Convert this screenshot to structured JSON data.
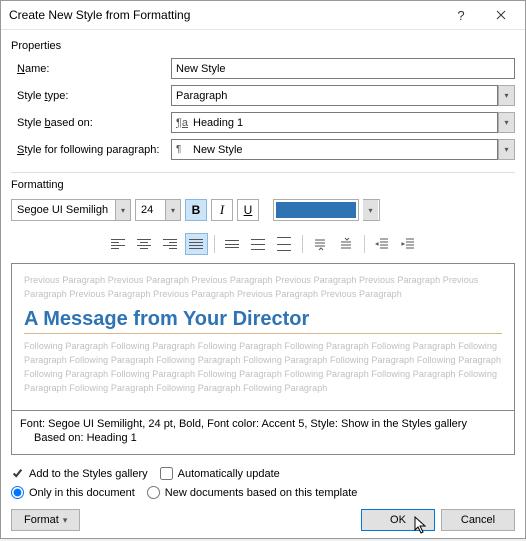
{
  "titlebar": {
    "title": "Create New Style from Formatting"
  },
  "sections": {
    "properties": "Properties",
    "formatting": "Formatting"
  },
  "props": {
    "name_label": "Name:",
    "name_value": "New Style",
    "styletype_label": "Style type:",
    "styletype_value": "Paragraph",
    "basedon_label": "Style based on:",
    "basedon_value": "Heading 1",
    "following_label": "Style for following paragraph:",
    "following_value": "New Style"
  },
  "format": {
    "font_name": "Segoe UI Semiligh",
    "font_size": "24",
    "bold": "B",
    "italic": "I",
    "underline": "U",
    "color": "#2e74b5"
  },
  "preview": {
    "ghost_prev": "Previous Paragraph Previous Paragraph Previous Paragraph Previous Paragraph Previous Paragraph Previous Paragraph Previous Paragraph Previous Paragraph Previous Paragraph Previous Paragraph",
    "heading": "A Message from Your Director",
    "ghost_next": "Following Paragraph Following Paragraph Following Paragraph Following Paragraph Following Paragraph Following Paragraph Following Paragraph Following Paragraph Following Paragraph Following Paragraph Following Paragraph Following Paragraph Following Paragraph Following Paragraph Following Paragraph Following Paragraph Following Paragraph Following Paragraph Following Paragraph Following Paragraph"
  },
  "description": {
    "line1": "Font: Segoe UI Semilight, 24 pt, Bold, Font color: Accent 5, Style: Show in the Styles gallery",
    "line2": "Based on: Heading 1"
  },
  "options": {
    "add_gallery": "Add to the Styles gallery",
    "auto_update": "Automatically update",
    "only_doc": "Only in this document",
    "new_docs": "New documents based on this template"
  },
  "buttons": {
    "format": "Format",
    "ok": "OK",
    "cancel": "Cancel"
  }
}
